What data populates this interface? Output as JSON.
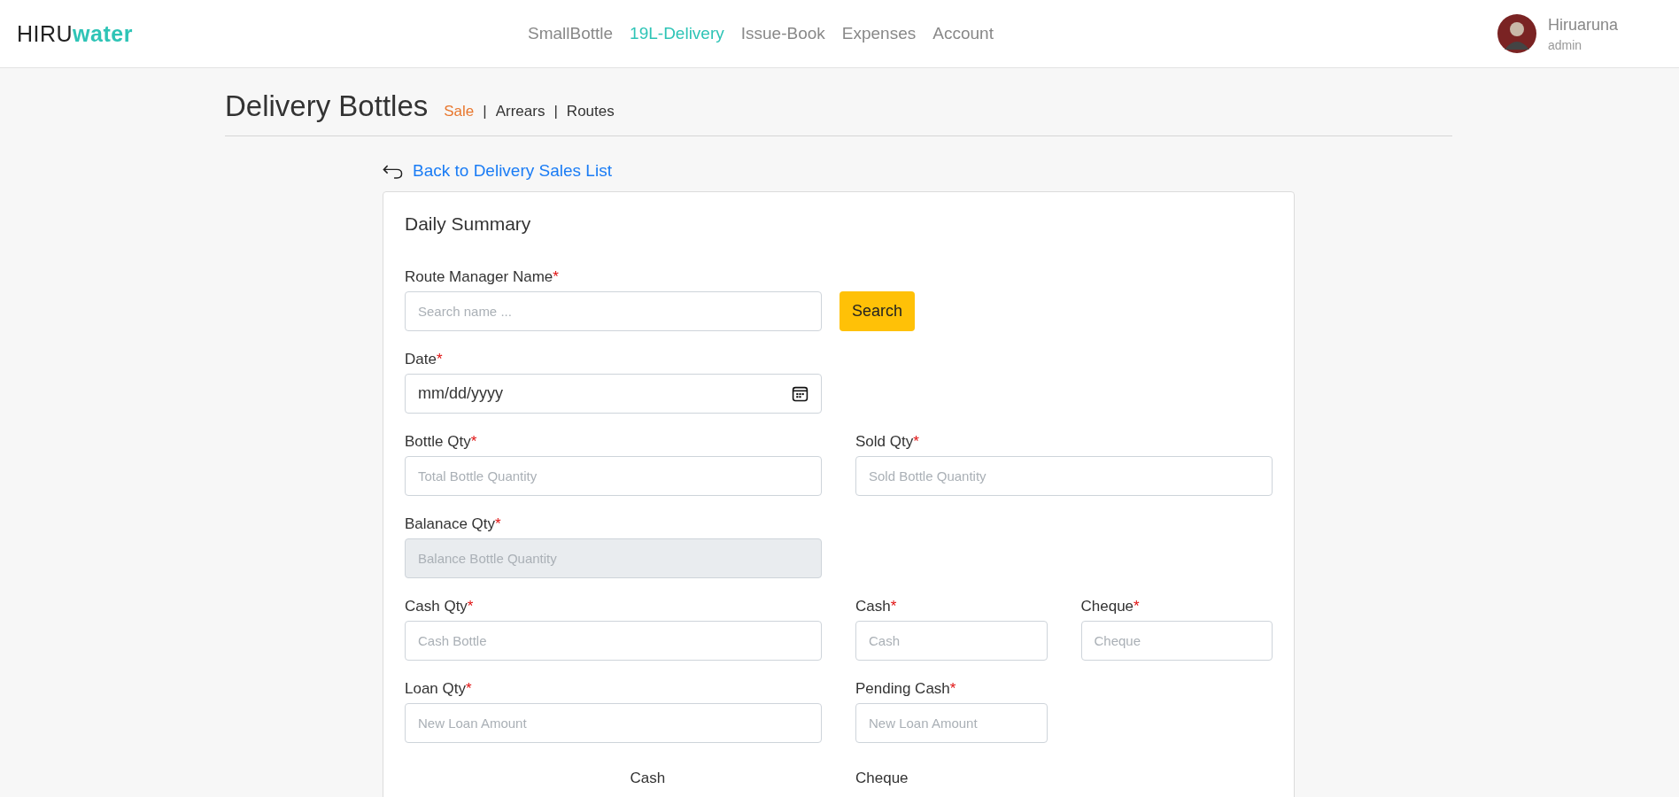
{
  "header": {
    "logo": {
      "part_1": "HIRU",
      "part_2": "water"
    },
    "nav": [
      {
        "label": "SmallBottle",
        "selected": false
      },
      {
        "label": "19L-Delivery",
        "selected": true
      },
      {
        "label": "Issue-Book",
        "selected": false
      },
      {
        "label": "Expenses",
        "selected": false
      },
      {
        "label": "Account",
        "selected": false
      }
    ],
    "user": {
      "name": "Hiruaruna",
      "role": "admin"
    }
  },
  "page": {
    "title": "Delivery Bottles",
    "subnav": [
      {
        "kind": "link",
        "label": "Sale",
        "selected": true
      },
      {
        "kind": "separator",
        "label": "|"
      },
      {
        "kind": "link",
        "label": "Arrears",
        "selected": false
      },
      {
        "kind": "separator",
        "label": "|"
      },
      {
        "kind": "link",
        "label": "Routes",
        "selected": false
      }
    ],
    "back_link": "Back to Delivery Sales List"
  },
  "card": {
    "title": "Daily Summary",
    "rows": [
      {
        "fields": [
          {
            "kind": "wide",
            "label": "Route Manager Name",
            "required_mark": "*",
            "placeholder": "Search name ...",
            "disabled": false
          }
        ],
        "button": "Search"
      },
      {
        "fields": [
          {
            "kind": "date",
            "label": "Date",
            "required_mark": "*",
            "value": "mm/dd/yyyy",
            "disabled": false
          }
        ]
      },
      {
        "fields": [
          {
            "kind": "wide",
            "label": "Bottle Qty",
            "required_mark": "*",
            "placeholder": "Total Bottle Quantity",
            "disabled": false
          },
          {
            "kind": "wide",
            "label": "Sold Qty",
            "required_mark": "*",
            "placeholder": "Sold Bottle Quantity",
            "disabled": false
          }
        ]
      },
      {
        "fields": [
          {
            "kind": "wide",
            "label": "Balanace Qty",
            "required_mark": "*",
            "placeholder": "Balance Bottle Quantity",
            "disabled": true
          }
        ]
      },
      {
        "fields": [
          {
            "kind": "wide",
            "label": "Cash Qty",
            "required_mark": "*",
            "placeholder": "Cash Bottle",
            "disabled": false
          },
          {
            "kind": "narrow",
            "label": "Cash",
            "required_mark": "*",
            "placeholder": "Cash",
            "disabled": false
          },
          {
            "kind": "narrow",
            "label": "Cheque",
            "required_mark": "*",
            "placeholder": "Cheque",
            "disabled": false
          }
        ]
      },
      {
        "fields": [
          {
            "kind": "wide",
            "label": "Loan Qty",
            "required_mark": "*",
            "placeholder": "New Loan Amount",
            "disabled": false
          },
          {
            "kind": "narrow",
            "label": "Pending Cash",
            "required_mark": "*",
            "placeholder": "New Loan Amount",
            "disabled": false
          }
        ]
      }
    ],
    "footer_labels": [
      "Cash",
      "Cheque"
    ]
  }
}
